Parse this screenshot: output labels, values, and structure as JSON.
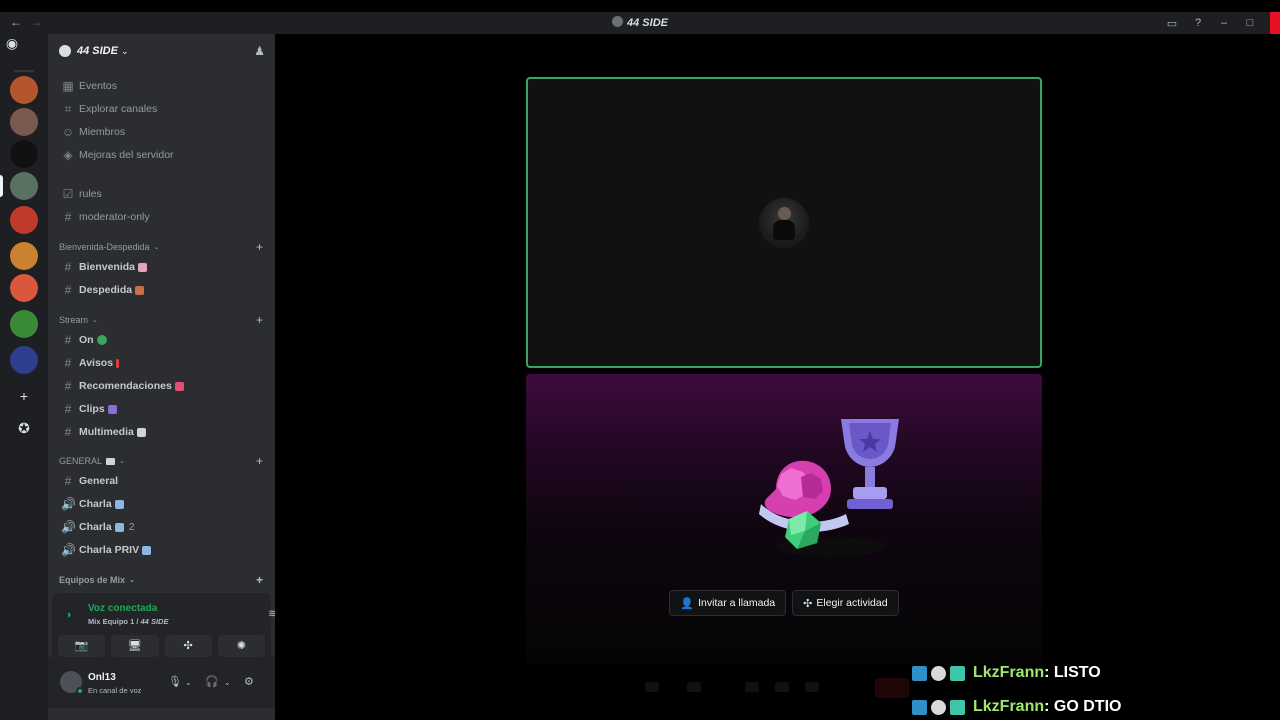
{
  "window": {
    "title": "44 SIDE",
    "nav_back": "←",
    "nav_forward": "→",
    "controls": {
      "inbox": "▭",
      "help": "?",
      "minimize": "–",
      "maximize": "□"
    }
  },
  "rail": {
    "home_icon": "discord-logo-icon",
    "add_server": "+",
    "explore": "✪",
    "server_colors": [
      "#b5552d",
      "#7a5a4e",
      "#111111",
      "#5a7060",
      "#c0392b",
      "#c9822f",
      "#d9573a",
      "#3a8a3a",
      "#2f3f8f"
    ]
  },
  "server": {
    "name": "44 SIDE",
    "chevron": "⌄",
    "invite_icon": "♟"
  },
  "sidebar": {
    "top_items": [
      {
        "icon": "▦",
        "label": "Eventos"
      },
      {
        "icon": "⌗",
        "label": "Explorar canales"
      },
      {
        "icon": "☺",
        "label": "Miembros"
      },
      {
        "icon": "◈",
        "label": "Mejoras del servidor"
      }
    ],
    "loose_channels": [
      {
        "icon": "☑",
        "label": "rules"
      },
      {
        "icon": "#",
        "label": "moderator-only"
      }
    ],
    "categories": [
      {
        "name": "Bienvenida-Despedida",
        "channels": [
          {
            "icon": "#",
            "label": "Bienvenida",
            "emoji_color": "#e7a2b6"
          },
          {
            "icon": "#",
            "label": "Despedida",
            "emoji_color": "#c8704a"
          }
        ]
      },
      {
        "name": "Stream",
        "channels": [
          {
            "icon": "#",
            "label": "On",
            "emoji_color": "#3ba55d"
          },
          {
            "icon": "#",
            "label": "Avisos",
            "emoji_color": "#e03c3c"
          },
          {
            "icon": "#",
            "label": "Recomendaciones",
            "emoji_color": "#e0507a"
          },
          {
            "icon": "#",
            "label": "Clips",
            "emoji_color": "#8a6fd6"
          },
          {
            "icon": "#",
            "label": "Multimedia",
            "emoji_color": "#cfd3d8"
          }
        ]
      },
      {
        "name": "GENERAL",
        "channels": [
          {
            "icon": "#",
            "label": "General"
          },
          {
            "icon": "🔊",
            "label": "Charla",
            "emoji_color": "#8fb6e0"
          },
          {
            "icon": "🔊",
            "label": "Charla",
            "emoji_color": "#8fb6e0",
            "count": "2"
          },
          {
            "icon": "🔊",
            "label": "Charla PRIV",
            "emoji_color": "#8fb6e0"
          }
        ]
      },
      {
        "name": "Equipos de Mix",
        "channels": []
      }
    ]
  },
  "voice": {
    "status": "Voz conectada",
    "channel": "Mix Equipo 1 / ",
    "server": "44 SIDE",
    "buttons": [
      "📷",
      "🖥",
      "✣",
      "✺"
    ]
  },
  "user": {
    "name": "Onl13",
    "status": "En canal de voz"
  },
  "call": {
    "invite_label": "Invitar a llamada",
    "activity_label": "Elegir actividad"
  },
  "chat": [
    {
      "user": "LkzFrann",
      "text": " : LISTO"
    },
    {
      "user": "LkzFrann",
      "text": " : GO DTIO"
    }
  ]
}
